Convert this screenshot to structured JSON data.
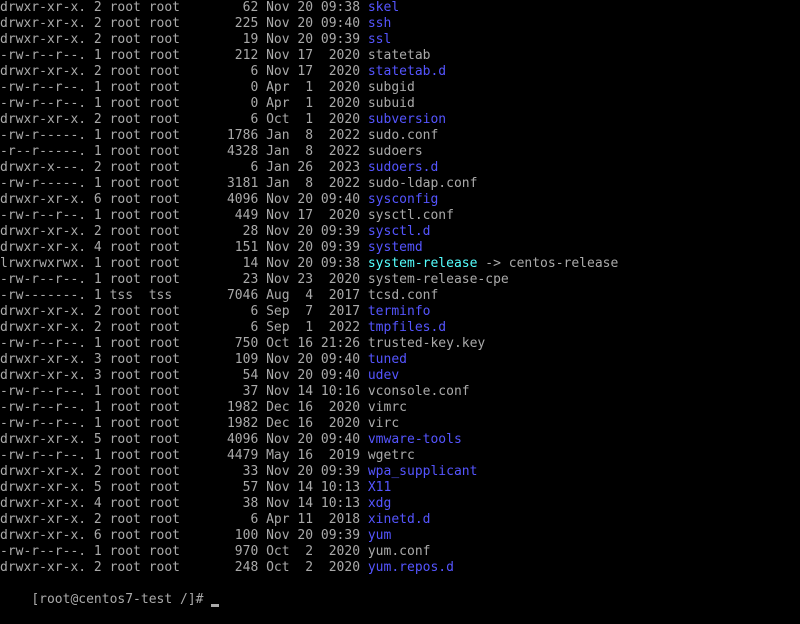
{
  "colors": {
    "background": "#000000",
    "text": "#aaaaaa",
    "directory": "#5555ff",
    "symlink": "#55ffff"
  },
  "listing": [
    {
      "perms": "drwxr-xr-x.",
      "links": "2",
      "owner": "root",
      "group": "root",
      "size": "62",
      "month": "Nov",
      "day": "20",
      "time": "09:38",
      "name": "skel",
      "type": "dir"
    },
    {
      "perms": "drwxr-xr-x.",
      "links": "2",
      "owner": "root",
      "group": "root",
      "size": "225",
      "month": "Nov",
      "day": "20",
      "time": "09:40",
      "name": "ssh",
      "type": "dir"
    },
    {
      "perms": "drwxr-xr-x.",
      "links": "2",
      "owner": "root",
      "group": "root",
      "size": "19",
      "month": "Nov",
      "day": "20",
      "time": "09:39",
      "name": "ssl",
      "type": "dir"
    },
    {
      "perms": "-rw-r--r--.",
      "links": "1",
      "owner": "root",
      "group": "root",
      "size": "212",
      "month": "Nov",
      "day": "17",
      "time": "2020",
      "name": "statetab",
      "type": "file"
    },
    {
      "perms": "drwxr-xr-x.",
      "links": "2",
      "owner": "root",
      "group": "root",
      "size": "6",
      "month": "Nov",
      "day": "17",
      "time": "2020",
      "name": "statetab.d",
      "type": "dir"
    },
    {
      "perms": "-rw-r--r--.",
      "links": "1",
      "owner": "root",
      "group": "root",
      "size": "0",
      "month": "Apr",
      "day": "1",
      "time": "2020",
      "name": "subgid",
      "type": "file"
    },
    {
      "perms": "-rw-r--r--.",
      "links": "1",
      "owner": "root",
      "group": "root",
      "size": "0",
      "month": "Apr",
      "day": "1",
      "time": "2020",
      "name": "subuid",
      "type": "file"
    },
    {
      "perms": "drwxr-xr-x.",
      "links": "2",
      "owner": "root",
      "group": "root",
      "size": "6",
      "month": "Oct",
      "day": "1",
      "time": "2020",
      "name": "subversion",
      "type": "dir"
    },
    {
      "perms": "-rw-r-----.",
      "links": "1",
      "owner": "root",
      "group": "root",
      "size": "1786",
      "month": "Jan",
      "day": "8",
      "time": "2022",
      "name": "sudo.conf",
      "type": "file"
    },
    {
      "perms": "-r--r-----.",
      "links": "1",
      "owner": "root",
      "group": "root",
      "size": "4328",
      "month": "Jan",
      "day": "8",
      "time": "2022",
      "name": "sudoers",
      "type": "file"
    },
    {
      "perms": "drwxr-x---.",
      "links": "2",
      "owner": "root",
      "group": "root",
      "size": "6",
      "month": "Jan",
      "day": "26",
      "time": "2023",
      "name": "sudoers.d",
      "type": "dir"
    },
    {
      "perms": "-rw-r-----.",
      "links": "1",
      "owner": "root",
      "group": "root",
      "size": "3181",
      "month": "Jan",
      "day": "8",
      "time": "2022",
      "name": "sudo-ldap.conf",
      "type": "file"
    },
    {
      "perms": "drwxr-xr-x.",
      "links": "6",
      "owner": "root",
      "group": "root",
      "size": "4096",
      "month": "Nov",
      "day": "20",
      "time": "09:40",
      "name": "sysconfig",
      "type": "dir"
    },
    {
      "perms": "-rw-r--r--.",
      "links": "1",
      "owner": "root",
      "group": "root",
      "size": "449",
      "month": "Nov",
      "day": "17",
      "time": "2020",
      "name": "sysctl.conf",
      "type": "file"
    },
    {
      "perms": "drwxr-xr-x.",
      "links": "2",
      "owner": "root",
      "group": "root",
      "size": "28",
      "month": "Nov",
      "day": "20",
      "time": "09:39",
      "name": "sysctl.d",
      "type": "dir"
    },
    {
      "perms": "drwxr-xr-x.",
      "links": "4",
      "owner": "root",
      "group": "root",
      "size": "151",
      "month": "Nov",
      "day": "20",
      "time": "09:39",
      "name": "systemd",
      "type": "dir"
    },
    {
      "perms": "lrwxrwxrwx.",
      "links": "1",
      "owner": "root",
      "group": "root",
      "size": "14",
      "month": "Nov",
      "day": "20",
      "time": "09:38",
      "name": "system-release",
      "type": "link",
      "target": "-> centos-release"
    },
    {
      "perms": "-rw-r--r--.",
      "links": "1",
      "owner": "root",
      "group": "root",
      "size": "23",
      "month": "Nov",
      "day": "23",
      "time": "2020",
      "name": "system-release-cpe",
      "type": "file"
    },
    {
      "perms": "-rw-------.",
      "links": "1",
      "owner": "tss",
      "group": "tss",
      "size": "7046",
      "month": "Aug",
      "day": "4",
      "time": "2017",
      "name": "tcsd.conf",
      "type": "file"
    },
    {
      "perms": "drwxr-xr-x.",
      "links": "2",
      "owner": "root",
      "group": "root",
      "size": "6",
      "month": "Sep",
      "day": "7",
      "time": "2017",
      "name": "terminfo",
      "type": "dir"
    },
    {
      "perms": "drwxr-xr-x.",
      "links": "2",
      "owner": "root",
      "group": "root",
      "size": "6",
      "month": "Sep",
      "day": "1",
      "time": "2022",
      "name": "tmpfiles.d",
      "type": "dir"
    },
    {
      "perms": "-rw-r--r--.",
      "links": "1",
      "owner": "root",
      "group": "root",
      "size": "750",
      "month": "Oct",
      "day": "16",
      "time": "21:26",
      "name": "trusted-key.key",
      "type": "file"
    },
    {
      "perms": "drwxr-xr-x.",
      "links": "3",
      "owner": "root",
      "group": "root",
      "size": "109",
      "month": "Nov",
      "day": "20",
      "time": "09:40",
      "name": "tuned",
      "type": "dir"
    },
    {
      "perms": "drwxr-xr-x.",
      "links": "3",
      "owner": "root",
      "group": "root",
      "size": "54",
      "month": "Nov",
      "day": "20",
      "time": "09:40",
      "name": "udev",
      "type": "dir"
    },
    {
      "perms": "-rw-r--r--.",
      "links": "1",
      "owner": "root",
      "group": "root",
      "size": "37",
      "month": "Nov",
      "day": "14",
      "time": "10:16",
      "name": "vconsole.conf",
      "type": "file"
    },
    {
      "perms": "-rw-r--r--.",
      "links": "1",
      "owner": "root",
      "group": "root",
      "size": "1982",
      "month": "Dec",
      "day": "16",
      "time": "2020",
      "name": "vimrc",
      "type": "file"
    },
    {
      "perms": "-rw-r--r--.",
      "links": "1",
      "owner": "root",
      "group": "root",
      "size": "1982",
      "month": "Dec",
      "day": "16",
      "time": "2020",
      "name": "virc",
      "type": "file"
    },
    {
      "perms": "drwxr-xr-x.",
      "links": "5",
      "owner": "root",
      "group": "root",
      "size": "4096",
      "month": "Nov",
      "day": "20",
      "time": "09:40",
      "name": "vmware-tools",
      "type": "dir"
    },
    {
      "perms": "-rw-r--r--.",
      "links": "1",
      "owner": "root",
      "group": "root",
      "size": "4479",
      "month": "May",
      "day": "16",
      "time": "2019",
      "name": "wgetrc",
      "type": "file"
    },
    {
      "perms": "drwxr-xr-x.",
      "links": "2",
      "owner": "root",
      "group": "root",
      "size": "33",
      "month": "Nov",
      "day": "20",
      "time": "09:39",
      "name": "wpa_supplicant",
      "type": "dir"
    },
    {
      "perms": "drwxr-xr-x.",
      "links": "5",
      "owner": "root",
      "group": "root",
      "size": "57",
      "month": "Nov",
      "day": "14",
      "time": "10:13",
      "name": "X11",
      "type": "dir"
    },
    {
      "perms": "drwxr-xr-x.",
      "links": "4",
      "owner": "root",
      "group": "root",
      "size": "38",
      "month": "Nov",
      "day": "14",
      "time": "10:13",
      "name": "xdg",
      "type": "dir"
    },
    {
      "perms": "drwxr-xr-x.",
      "links": "2",
      "owner": "root",
      "group": "root",
      "size": "6",
      "month": "Apr",
      "day": "11",
      "time": "2018",
      "name": "xinetd.d",
      "type": "dir"
    },
    {
      "perms": "drwxr-xr-x.",
      "links": "6",
      "owner": "root",
      "group": "root",
      "size": "100",
      "month": "Nov",
      "day": "20",
      "time": "09:39",
      "name": "yum",
      "type": "dir"
    },
    {
      "perms": "-rw-r--r--.",
      "links": "1",
      "owner": "root",
      "group": "root",
      "size": "970",
      "month": "Oct",
      "day": "2",
      "time": "2020",
      "name": "yum.conf",
      "type": "file"
    },
    {
      "perms": "drwxr-xr-x.",
      "links": "2",
      "owner": "root",
      "group": "root",
      "size": "248",
      "month": "Oct",
      "day": "2",
      "time": "2020",
      "name": "yum.repos.d",
      "type": "dir"
    }
  ],
  "prompt": "[root@centos7-test /]#"
}
